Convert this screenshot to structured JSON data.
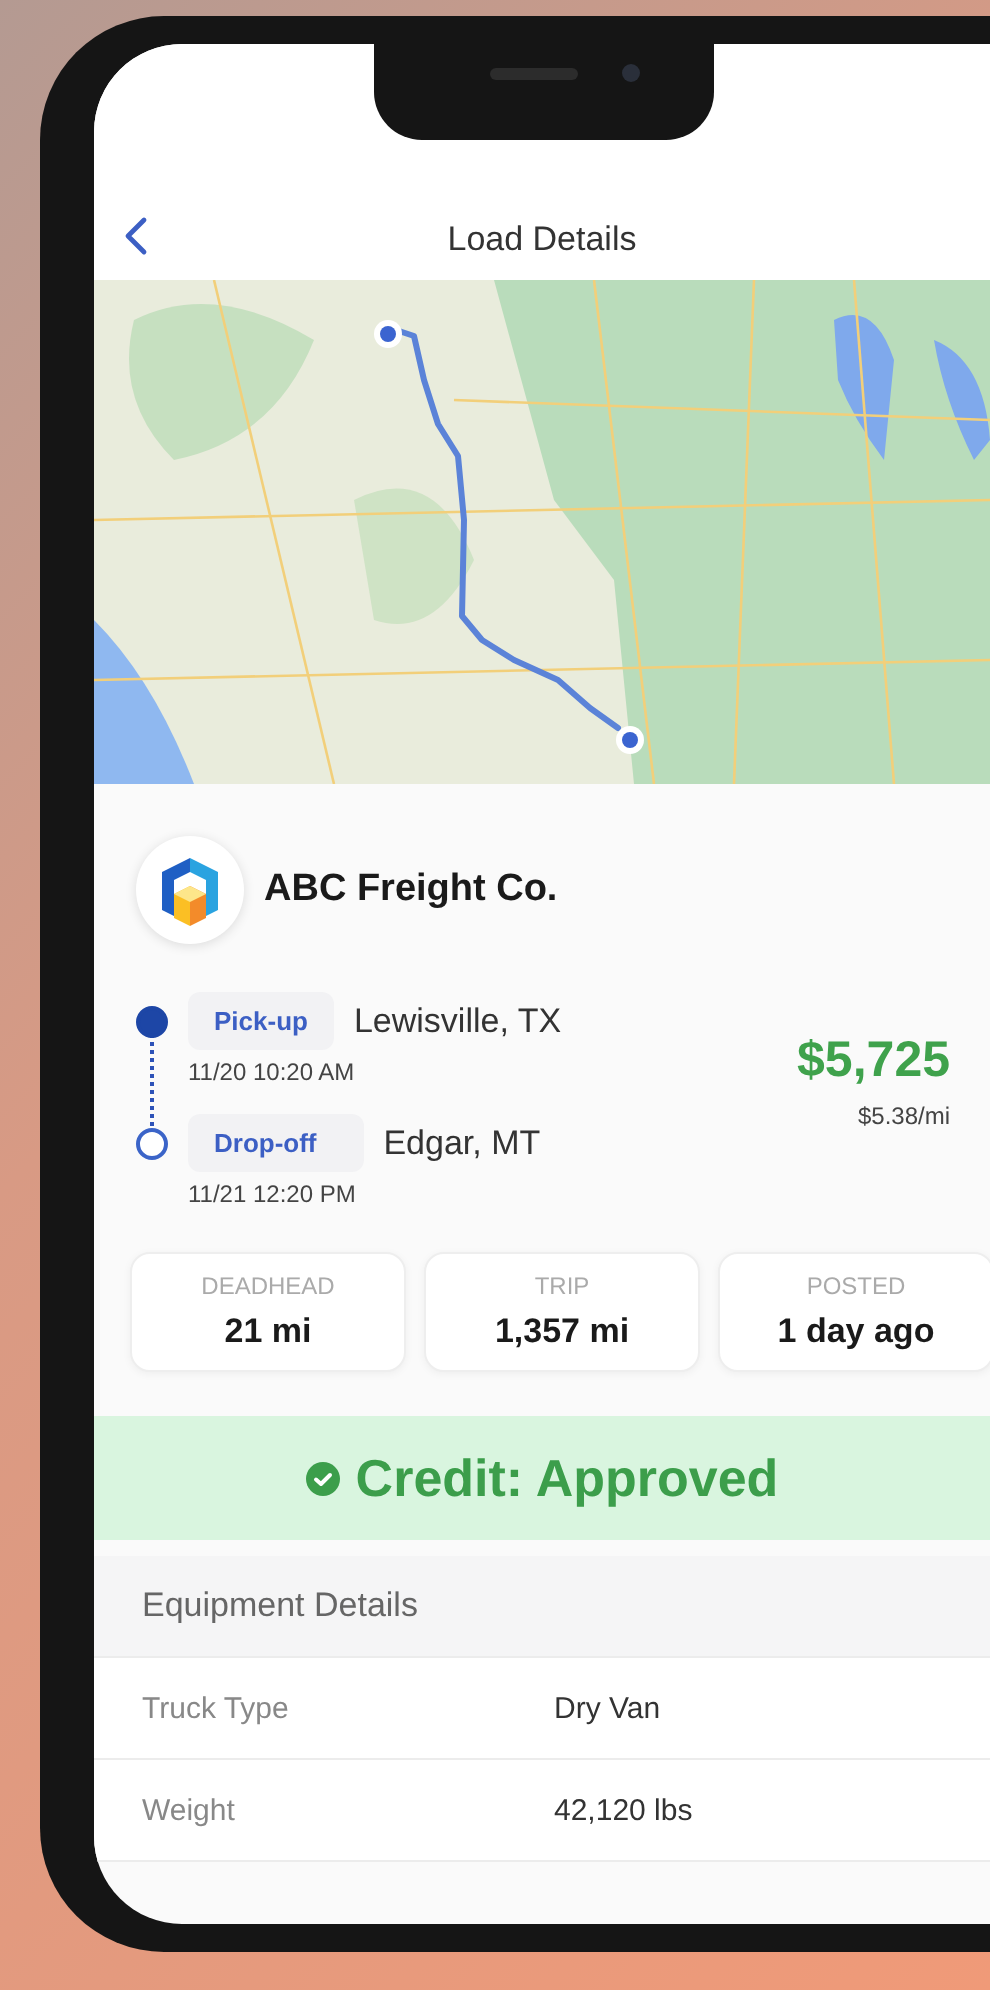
{
  "header": {
    "title": "Load Details"
  },
  "carrier": {
    "name": "ABC Freight Co."
  },
  "stops": [
    {
      "kind": "pickup",
      "label": "Pick-up",
      "location": "Lewisville, TX",
      "time": "11/20 10:20 AM"
    },
    {
      "kind": "dropoff",
      "label": "Drop-off",
      "location": "Edgar, MT",
      "time": "11/21 12:20 PM"
    }
  ],
  "price": {
    "total": "$5,725",
    "rate": "$5.38/mi"
  },
  "stats": [
    {
      "label": "DEADHEAD",
      "value": "21 mi"
    },
    {
      "label": "TRIP",
      "value": "1,357 mi"
    },
    {
      "label": "POSTED",
      "value": "1 day ago"
    }
  ],
  "credit": {
    "approved": true,
    "text": "Credit: Approved"
  },
  "equipment": {
    "title": "Equipment Details",
    "rows": [
      {
        "label": "Truck Type",
        "value": "Dry Van"
      },
      {
        "label": "Weight",
        "value": "42,120 lbs"
      }
    ]
  }
}
